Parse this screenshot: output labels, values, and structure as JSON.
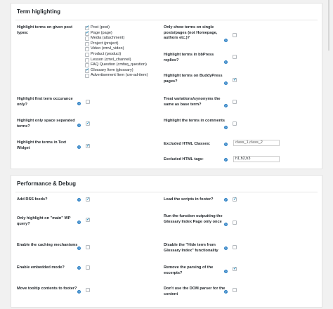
{
  "section1": {
    "title": "Term higlighting",
    "post_types_label": "Highlight terms on given post types:",
    "post_types": [
      {
        "label": "Post (post)",
        "checked": true
      },
      {
        "label": "Page (page)",
        "checked": true
      },
      {
        "label": "Media (attachment)",
        "checked": false
      },
      {
        "label": "Project (project)",
        "checked": false
      },
      {
        "label": "Video (cmvl_video)",
        "checked": false
      },
      {
        "label": "Product (product)",
        "checked": false
      },
      {
        "label": "Lesson (cmvl_channel)",
        "checked": false
      },
      {
        "label": "FAQ Question (cmfaq_question)",
        "checked": false
      },
      {
        "label": "Glossary Item (glossary)",
        "checked": true
      },
      {
        "label": "Advertisement Item (cm-ad-item)",
        "checked": false
      }
    ],
    "only_single_label": "Only show terms on single posts/pages (not Homepage, authors etc.)?",
    "bbpress_label": "Highlight terms in bbPress replies?",
    "buddypress_label": "Highlight terms on BuddyPress pages?",
    "first_occurance_label": "Highlight first term occurance only?",
    "synonyms_label": "Treat variations/synonyms the same as base term?",
    "space_separated_label": "Highlight only space separated terms?",
    "comments_label": "Highlight the terms in comments",
    "text_widget_label": "Highlight the terms in Text Widget",
    "excluded_classes_label": "Excluded HTML Classes:",
    "excluded_classes_placeholder": "class_1,class_2",
    "excluded_tags_label": "Excluded HTML tags:",
    "excluded_tags_value": "h1,h2,h3"
  },
  "section2": {
    "title": "Performance & Debug",
    "rss_label": "Add RSS feeds?",
    "footer_scripts_label": "Load the scripts in footer?",
    "main_wp_query_label": "Only highlight on \"main\" WP query?",
    "glossary_index_once_label": "Run the function outputting the Glossary Index Page only once",
    "caching_label": "Enable the caching mechanisms",
    "hide_term_label": "Disable the \"Hide term from Glossary Index\" functionality",
    "embedded_mode_label": "Enable embedded mode?",
    "remove_excerpts_label": "Remove the parsing of the excerpts?",
    "tooltip_footer_label": "Move tooltip contents to footer?",
    "no_dom_parser_label": "Don't use the DOM parser for the content"
  },
  "help_icon_glyph": "?",
  "accent_color": "#2a7fc4"
}
